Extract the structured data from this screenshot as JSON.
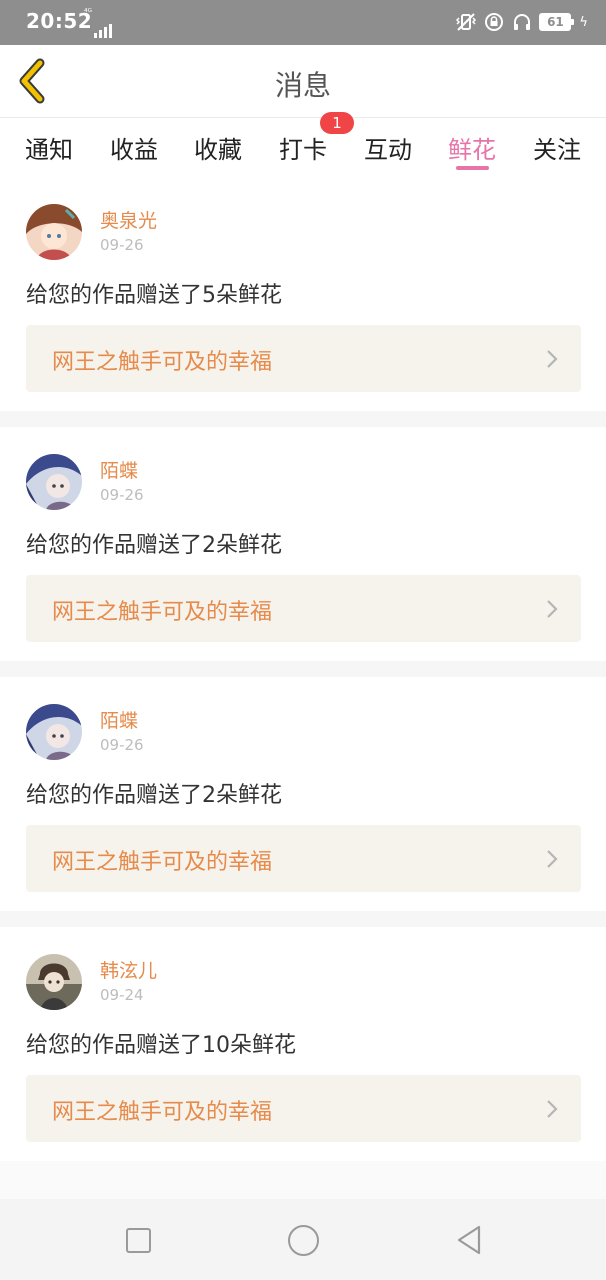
{
  "status_bar": {
    "time": "20:52",
    "network": "⁴ᴳ 4G",
    "battery": "61",
    "icons": [
      "vibrate-icon",
      "lock-rotation-icon",
      "headphones-icon",
      "battery-icon",
      "charging-icon"
    ]
  },
  "header": {
    "title": "消息",
    "back_icon": "back-chevron-icon"
  },
  "tabs": {
    "items": [
      {
        "label": "通知"
      },
      {
        "label": "收益"
      },
      {
        "label": "收藏"
      },
      {
        "label": "打卡",
        "badge": "1"
      },
      {
        "label": "互动"
      },
      {
        "label": "鲜花",
        "active": true
      },
      {
        "label": "关注"
      }
    ]
  },
  "messages": [
    {
      "user": "奥泉光",
      "date": "09-26",
      "text": "给您的作品赠送了5朵鲜花",
      "work_title": "网王之触手可及的幸福"
    },
    {
      "user": "陌蝶",
      "date": "09-26",
      "text": "给您的作品赠送了2朵鲜花",
      "work_title": "网王之触手可及的幸福"
    },
    {
      "user": "陌蝶",
      "date": "09-26",
      "text": "给您的作品赠送了2朵鲜花",
      "work_title": "网王之触手可及的幸福"
    },
    {
      "user": "韩泫儿",
      "date": "09-24",
      "text": "给您的作品赠送了10朵鲜花",
      "work_title": "网王之触手可及的幸福"
    }
  ],
  "colors": {
    "accent_pink": "#e774a8",
    "accent_orange": "#e68b4b",
    "back_yellow": "#f2c200",
    "badge_red": "#f04447",
    "card_bg": "#f5f3ec"
  },
  "navbar": {
    "icons": [
      "recent-apps-icon",
      "home-icon",
      "back-triangle-icon"
    ]
  }
}
